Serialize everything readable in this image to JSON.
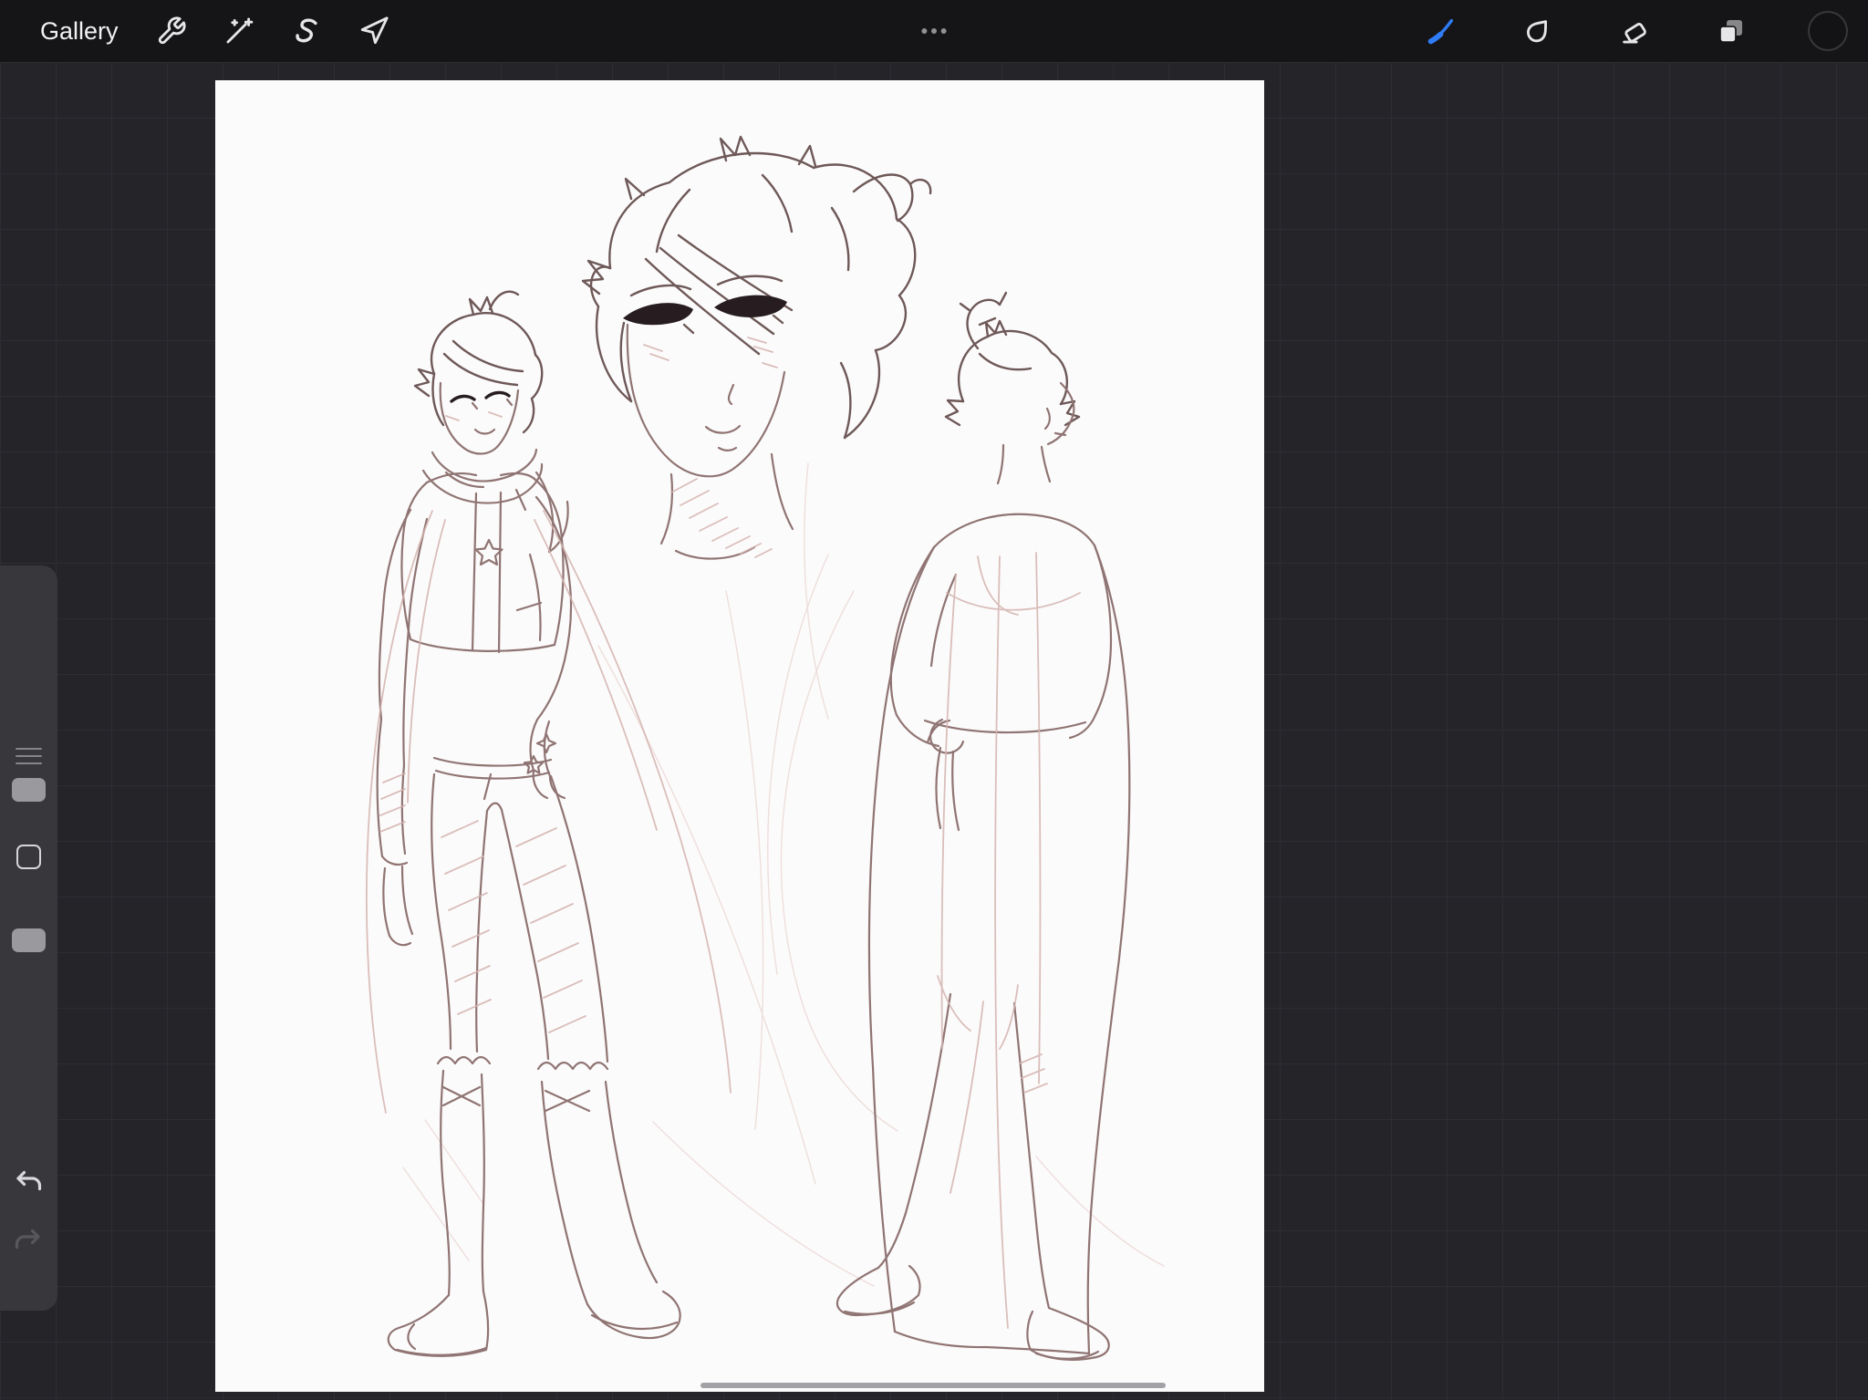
{
  "app": "Procreate",
  "colors": {
    "topbar-bg": "#151517",
    "workspace-bg": "#242429",
    "grid-line": "#2d2d33",
    "panel-bg": "#37373c",
    "icon": "#e6e6e9",
    "icon-dim": "#909095",
    "accent": "#2f7cf6",
    "canvas-bg": "#fcfbfb",
    "handle": "#9a999e",
    "undo": "#d9d9dc",
    "redo": "#57575c",
    "swatch": "#131316",
    "sketch-main": "#8f7473",
    "sketch-light": "#d3b4b0",
    "sketch-faint": "#e4cfcb",
    "sketch-dark": "#6e5858",
    "sketch-ink": "#271d20"
  },
  "topbar": {
    "gallery_label": "Gallery",
    "left_tools": [
      {
        "name": "actions",
        "icon": "wrench-icon"
      },
      {
        "name": "adjustments",
        "icon": "magic-wand-icon"
      },
      {
        "name": "selection",
        "icon": "selection-s-icon"
      },
      {
        "name": "transform",
        "icon": "move-arrow-icon"
      }
    ],
    "center": {
      "name": "canvas-options",
      "icon": "ellipsis-icon"
    },
    "right_tools": [
      {
        "name": "paint",
        "icon": "brush-icon",
        "active": true
      },
      {
        "name": "smudge",
        "icon": "smudge-finger-icon",
        "active": false
      },
      {
        "name": "erase",
        "icon": "eraser-icon",
        "active": false
      },
      {
        "name": "layers",
        "icon": "layers-icon",
        "active": false
      },
      {
        "name": "color",
        "icon": "color-swatch",
        "current_color": "#131316"
      }
    ]
  },
  "sidebar": {
    "controls": [
      "brush-size-slider",
      "modify-button",
      "opacity-slider",
      "undo-button",
      "redo-button"
    ]
  },
  "canvas": {
    "content": "anime-character-sketch",
    "figures": [
      "head-study",
      "front-view-full-body",
      "back-view-full-body"
    ]
  },
  "home_indicator": true
}
